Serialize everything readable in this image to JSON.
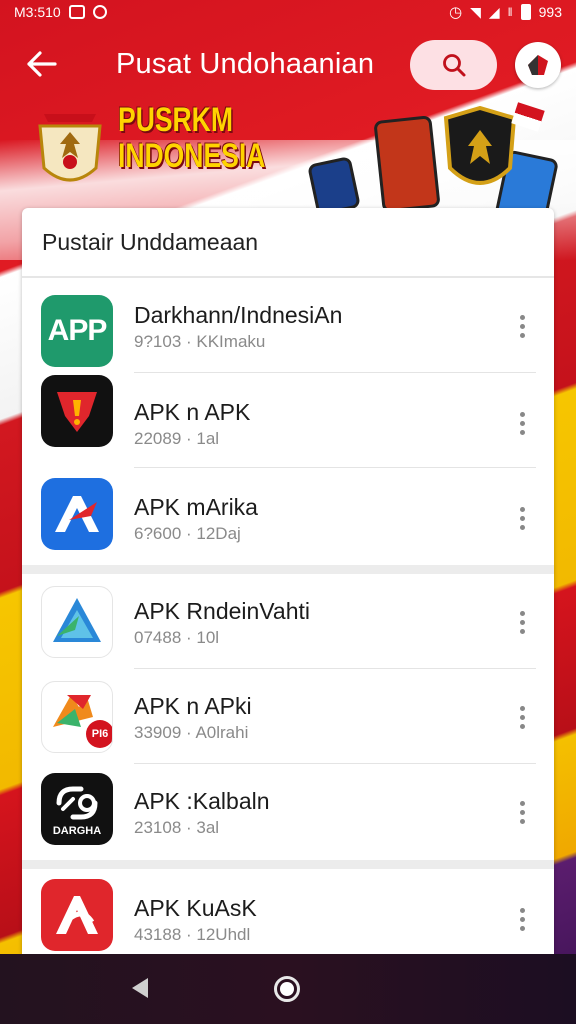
{
  "status_bar": {
    "time": "M3:510",
    "right_text": "993"
  },
  "app_bar": {
    "title": "Pusat Undohaanian",
    "back_icon": "arrow-left-icon",
    "search_icon": "search-icon",
    "avatar_icon": "avatar-badge-icon"
  },
  "banner": {
    "line1": "PUSRKM",
    "line2": "INDONESIA"
  },
  "card": {
    "header": "Pustair Unddameaan"
  },
  "apps": [
    {
      "name": "Darkhann/IndnesiAn",
      "meta": "9?103 · KKImaku",
      "icon_text": "APP",
      "icon": "app-green-icon"
    },
    {
      "name": "APK n APK",
      "meta": "22089 · 1al",
      "icon": "red-shield-icon"
    },
    {
      "name": "APK mArika",
      "meta": "6?600 · 12Daj",
      "icon": "blue-a-icon"
    },
    {
      "name": "APK RndeinVahti",
      "meta": "07488 · 10l",
      "icon": "triangle-arrow-icon"
    },
    {
      "name": "APK n APki",
      "meta": "33909 · A0lrahi",
      "icon": "orange-arrow-icon",
      "badge": "PI6"
    },
    {
      "name": "APK :Kalbaln",
      "meta": "23108 · 3al",
      "icon": "black-link-icon",
      "icon_caption": "DARGHA"
    },
    {
      "name": "APK KuAsK",
      "meta": "43188 · 12Uhdl",
      "icon": "red-a-icon"
    }
  ],
  "colors": {
    "accent_red": "#d3131f",
    "accent_yellow": "#f6c600",
    "search_pill": "#fde0e4",
    "app_green": "#1f9a6c",
    "app_blue": "#1e6fe0",
    "app_red": "#e0262c"
  }
}
